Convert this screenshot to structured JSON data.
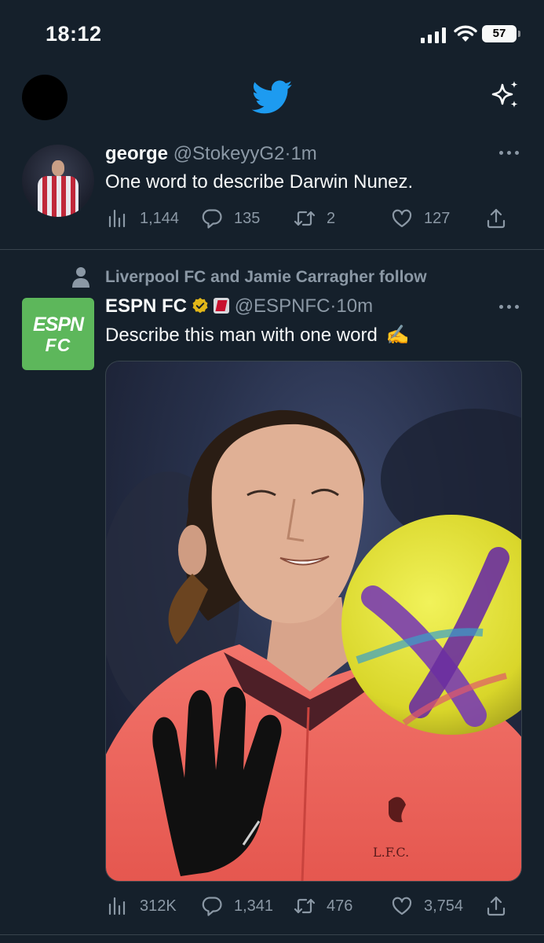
{
  "status_bar": {
    "time": "18:12",
    "battery": "57"
  },
  "tweets": [
    {
      "name": "george",
      "handle": "@StokeyyG2",
      "separator": "·",
      "time": "1m",
      "text": "One word to describe Darwin Nunez.",
      "views": "1,144",
      "replies": "135",
      "retweets": "2",
      "likes": "127"
    },
    {
      "context": "Liverpool FC and Jamie Carragher follow",
      "name": "ESPN FC",
      "handle": "@ESPNFC",
      "separator": "·",
      "time": "10m",
      "text": "Describe this man with one word",
      "emoji": "✍️",
      "avatar_top": "ESPN",
      "avatar_bottom": "FC",
      "views": "312K",
      "replies": "1,341",
      "retweets": "476",
      "likes": "3,754"
    }
  ],
  "colors": {
    "background": "#15202b",
    "accent": "#1d9bf0",
    "muted": "#8b98a5",
    "divider": "#38444d",
    "espn_green": "#5db75b"
  },
  "icons": [
    "signal-icon",
    "wifi-icon",
    "battery-icon",
    "twitter-bird-icon",
    "sparkle-icon",
    "more-icon",
    "views-icon",
    "reply-icon",
    "retweet-icon",
    "like-icon",
    "share-icon",
    "person-icon",
    "verified-badge-icon",
    "espn-e-icon"
  ]
}
